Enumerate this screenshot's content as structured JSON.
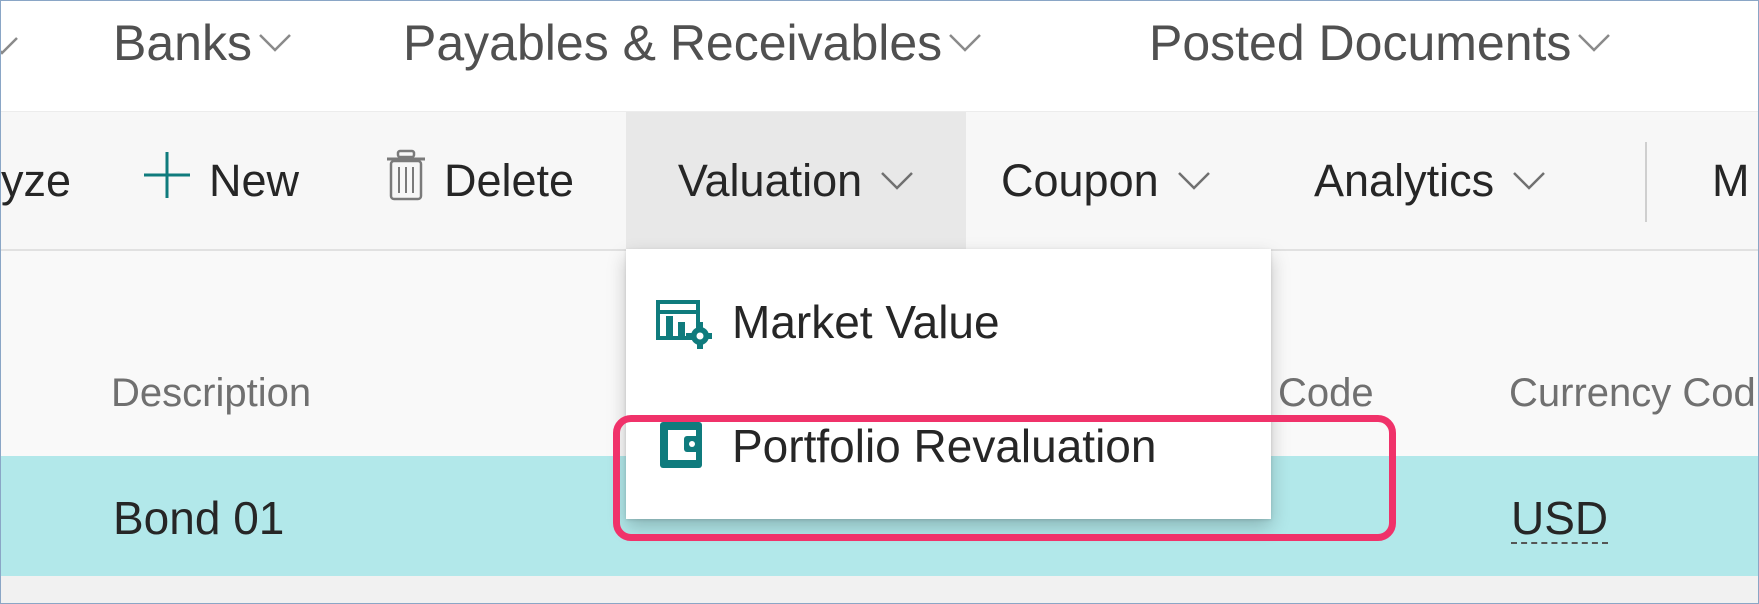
{
  "topnav": {
    "items": [
      {
        "label": "Banks"
      },
      {
        "label": "Payables & Receivables"
      },
      {
        "label": "Posted Documents"
      }
    ]
  },
  "actionbar": {
    "analyze_partial": "yze",
    "new_label": "New",
    "delete_label": "Delete",
    "valuation_label": "Valuation",
    "coupon_label": "Coupon",
    "analytics_label": "Analytics",
    "more_partial": "M"
  },
  "valuation_menu": {
    "items": [
      {
        "label": "Market Value",
        "icon": "market-value-icon"
      },
      {
        "label": "Portfolio Revaluation",
        "icon": "portfolio-revaluation-icon"
      }
    ]
  },
  "list": {
    "columns": {
      "description": "Description",
      "code": "Code",
      "currency_code": "Currency Cod"
    },
    "rows": [
      {
        "description": "Bond 01",
        "currency_code": "USD"
      }
    ]
  },
  "colors": {
    "accent_teal": "#0f7b7d",
    "selected_row": "#b2e8ea",
    "highlight": "#f0326a"
  }
}
